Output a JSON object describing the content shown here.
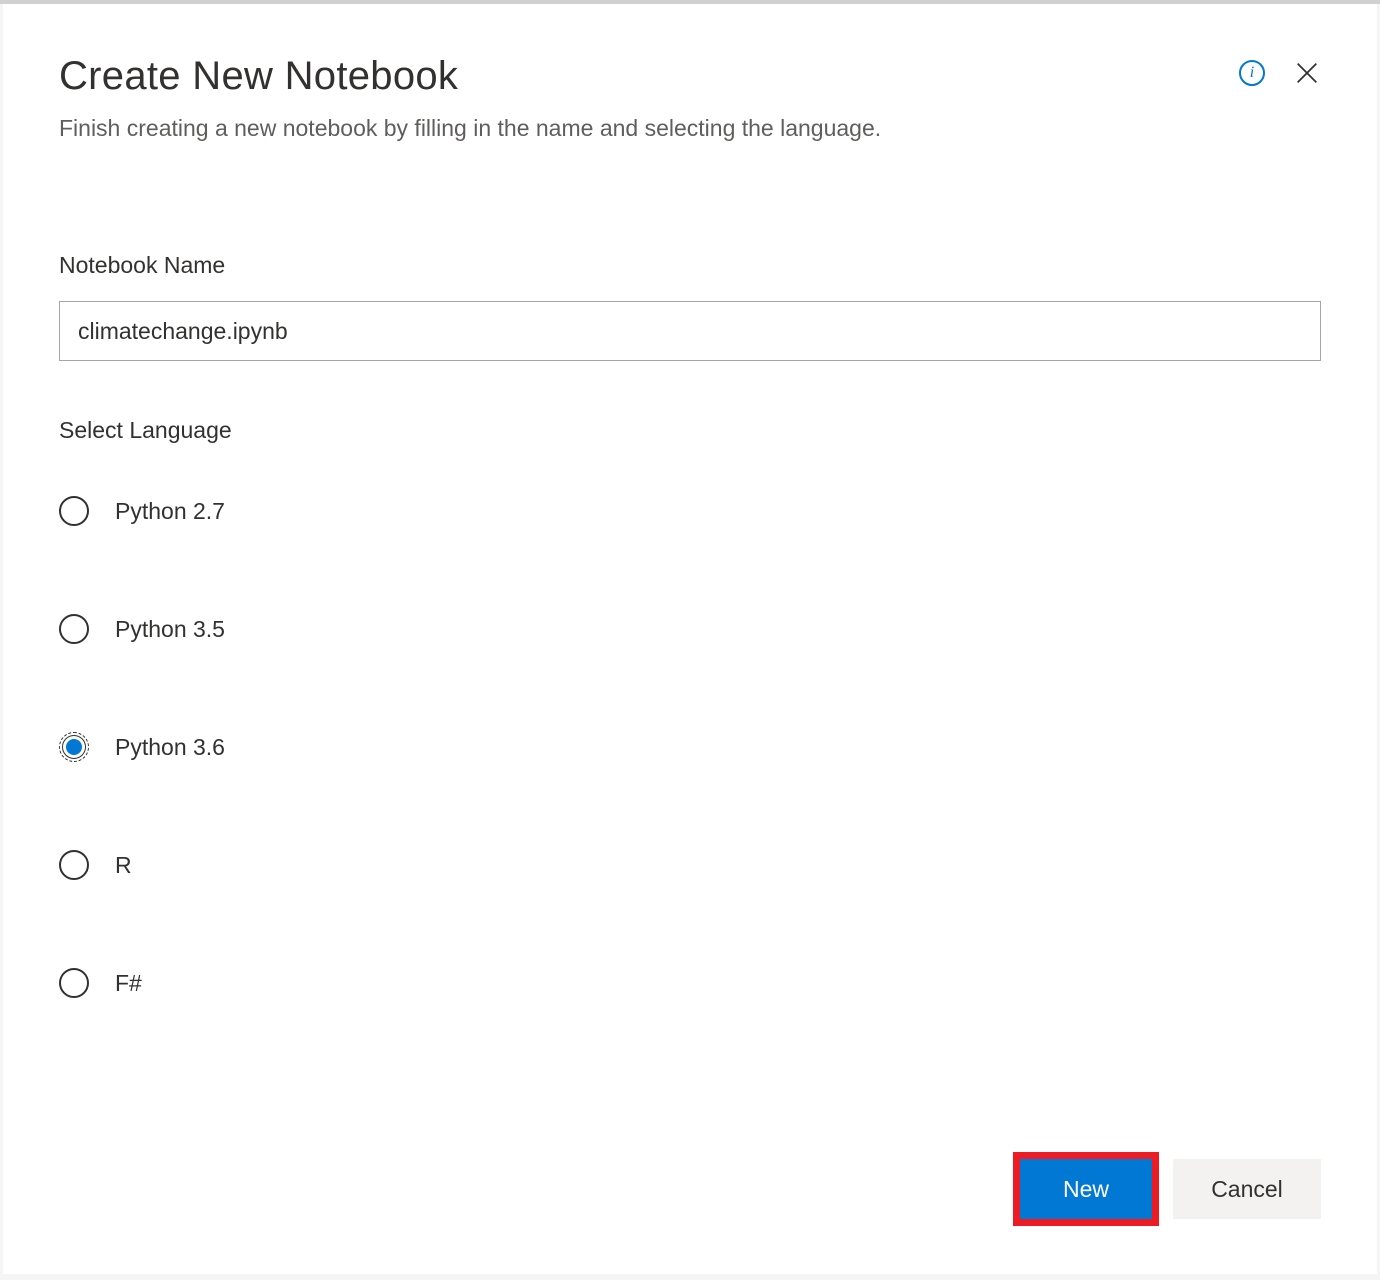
{
  "dialog": {
    "title": "Create New Notebook",
    "subtitle": "Finish creating a new notebook by filling in the name and selecting the language."
  },
  "form": {
    "name_label": "Notebook Name",
    "name_value": "climatechange.ipynb",
    "language_label": "Select Language",
    "languages": [
      {
        "label": "Python 2.7",
        "selected": false
      },
      {
        "label": "Python 3.5",
        "selected": false
      },
      {
        "label": "Python 3.6",
        "selected": true
      },
      {
        "label": "R",
        "selected": false
      },
      {
        "label": "F#",
        "selected": false
      }
    ]
  },
  "actions": {
    "primary": "New",
    "secondary": "Cancel"
  },
  "icons": {
    "info": "i"
  },
  "colors": {
    "accent": "#0078d4",
    "highlight_border": "#ed1c24",
    "text_primary": "#323130",
    "text_secondary": "#605e5c",
    "secondary_button_bg": "#f3f2f1"
  }
}
